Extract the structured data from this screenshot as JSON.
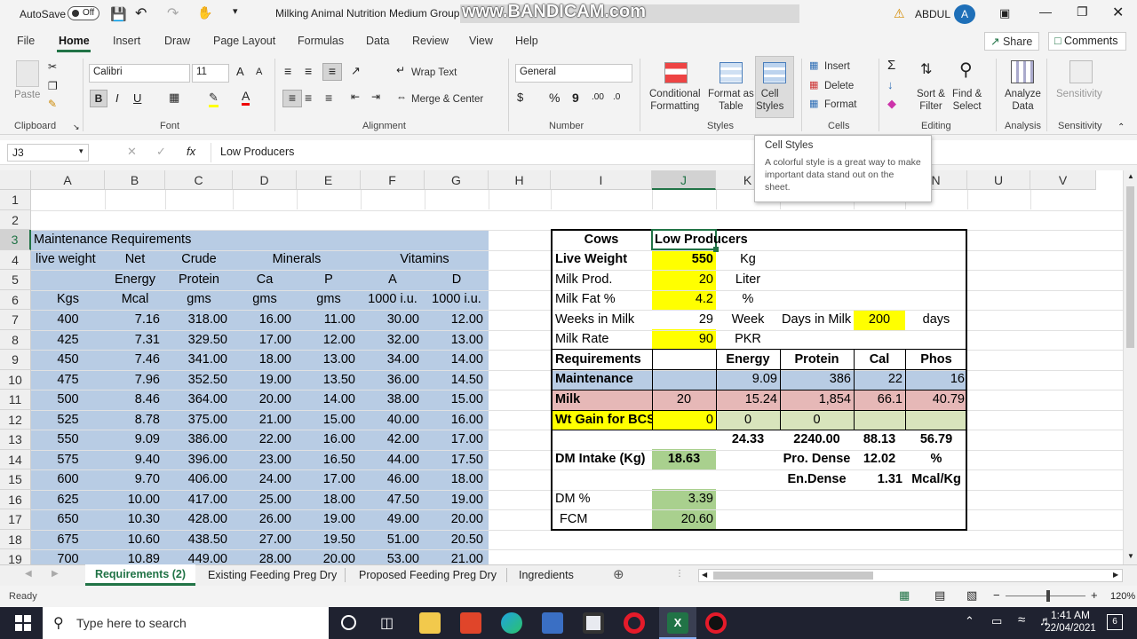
{
  "titlebar": {
    "autosave": "AutoSave",
    "autosave_state": "Off",
    "title": "Milking Animal Nutrition Medium Group",
    "watermark": "www.BANDICAM.com",
    "user": "ABDUL",
    "avatar": "A"
  },
  "menu": {
    "items": [
      "File",
      "Home",
      "Insert",
      "Draw",
      "Page Layout",
      "Formulas",
      "Data",
      "Review",
      "View",
      "Help"
    ],
    "share": "Share",
    "comments": "Comments"
  },
  "ribbon": {
    "clipboard": {
      "paste": "Paste",
      "group": "Clipboard"
    },
    "font": {
      "name": "Calibri",
      "size": "11",
      "bold": "B",
      "italic": "I",
      "underline": "U",
      "group": "Font",
      "grow": "A",
      "shrink": "A"
    },
    "alignment": {
      "wrap": "Wrap Text",
      "merge": "Merge & Center",
      "group": "Alignment"
    },
    "number": {
      "format": "General",
      "group": "Number",
      "currency": "$",
      "percent": "%",
      "comma": "9"
    },
    "styles": {
      "cond1": "Conditional",
      "cond2": "Formatting",
      "fmt1": "Format as",
      "fmt2": "Table",
      "cell1": "Cell",
      "cell2": "Styles",
      "group": "Styles"
    },
    "cells": {
      "insert": "Insert",
      "delete": "Delete",
      "format": "Format",
      "group": "Cells"
    },
    "editing": {
      "sort1": "Sort &",
      "sort2": "Filter",
      "find1": "Find &",
      "find2": "Select",
      "group": "Editing"
    },
    "analysis": {
      "a1": "Analyze",
      "a2": "Data",
      "group": "Analysis"
    },
    "sensitivity": {
      "s1": "Sensitivity",
      "group": "Sensitivity"
    }
  },
  "tooltip": {
    "title": "Cell Styles",
    "body": "A colorful style is a great way to make important data stand out on the sheet."
  },
  "formula_bar": {
    "name_box": "J3",
    "fx": "fx",
    "content": "Low Producers"
  },
  "columns": [
    "A",
    "B",
    "C",
    "D",
    "E",
    "F",
    "G",
    "H",
    "I",
    "J",
    "K",
    "L",
    "M",
    "N",
    "U",
    "V"
  ],
  "rows": [
    "1",
    "2",
    "3",
    "4",
    "5",
    "6",
    "7",
    "8",
    "9",
    "10",
    "11",
    "12",
    "13",
    "14",
    "15",
    "16",
    "17",
    "18",
    "19"
  ],
  "left_table": {
    "title": "Maintenance Requirements",
    "h1": [
      "live weight",
      "Net",
      "Crude",
      "Minerals",
      "Vitamins"
    ],
    "h2": [
      "Energy",
      "Protein",
      "Ca",
      "P",
      "A",
      "D"
    ],
    "h3": [
      "Kgs",
      "Mcal",
      "gms",
      "gms",
      "gms",
      "1000 i.u.",
      "1000 i.u."
    ],
    "data": [
      [
        "400",
        "7.16",
        "318.00",
        "16.00",
        "11.00",
        "30.00",
        "12.00"
      ],
      [
        "425",
        "7.31",
        "329.50",
        "17.00",
        "12.00",
        "32.00",
        "13.00"
      ],
      [
        "450",
        "7.46",
        "341.00",
        "18.00",
        "13.00",
        "34.00",
        "14.00"
      ],
      [
        "475",
        "7.96",
        "352.50",
        "19.00",
        "13.50",
        "36.00",
        "14.50"
      ],
      [
        "500",
        "8.46",
        "364.00",
        "20.00",
        "14.00",
        "38.00",
        "15.00"
      ],
      [
        "525",
        "8.78",
        "375.00",
        "21.00",
        "15.00",
        "40.00",
        "16.00"
      ],
      [
        "550",
        "9.09",
        "386.00",
        "22.00",
        "16.00",
        "42.00",
        "17.00"
      ],
      [
        "575",
        "9.40",
        "396.00",
        "23.00",
        "16.50",
        "44.00",
        "17.50"
      ],
      [
        "600",
        "9.70",
        "406.00",
        "24.00",
        "17.00",
        "46.00",
        "18.00"
      ],
      [
        "625",
        "10.00",
        "417.00",
        "25.00",
        "18.00",
        "47.50",
        "19.00"
      ],
      [
        "650",
        "10.30",
        "428.00",
        "26.00",
        "19.00",
        "49.00",
        "20.00"
      ],
      [
        "675",
        "10.60",
        "438.50",
        "27.00",
        "19.50",
        "51.00",
        "20.50"
      ],
      [
        "700",
        "10.89",
        "449.00",
        "28.00",
        "20.00",
        "53.00",
        "21.00"
      ]
    ]
  },
  "right_table": {
    "cows": "Cows",
    "low": "Low Producers",
    "live_weight": "Live Weight",
    "lw_val": "550",
    "kg": "Kg",
    "milk_prod": "Milk Prod.",
    "mp_val": "20",
    "liter": "Liter",
    "milk_fat": "Milk Fat %",
    "mf_val": "4.2",
    "pct": "%",
    "weeks": "Weeks in Milk",
    "wk_val": "29",
    "week": "Week",
    "days_in_milk": "Days in Milk",
    "dim_val": "200",
    "days": "days",
    "milk_rate": "Milk Rate",
    "mr_val": "90",
    "pkr": "PKR",
    "req": "Requirements",
    "energy": "Energy",
    "protein": "Protein",
    "cal": "Cal",
    "phos": "Phos",
    "maint": "Maintenance",
    "m_e": "9.09",
    "m_p": "386",
    "m_c": "22",
    "m_ph": "16",
    "milk": "Milk",
    "mk_j": "20",
    "mk_e": "15.24",
    "mk_p": "1,854",
    "mk_c": "66.1",
    "mk_ph": "40.79",
    "wtgain": "Wt Gain for BCS",
    "wg_j": "0",
    "wg_e": "0",
    "wg_p": "0",
    "t_e": "24.33",
    "t_p": "2240.00",
    "t_c": "88.13",
    "t_ph": "56.79",
    "dmi": "DM Intake (Kg)",
    "dmi_val": "18.63",
    "pro_dense": "Pro. Dense",
    "pd_val": "12.02",
    "pd_unit": "%",
    "en_dense": "En.Dense",
    "ed_val": "1.31",
    "ed_unit": "Mcal/Kg",
    "dm_pct": "DM %",
    "dm_val": "3.39",
    "fcm": "FCM",
    "fcm_val": "20.60"
  },
  "tabs": [
    "Requirements (2)",
    "Existing Feeding Preg Dry",
    "Proposed Feeding Preg Dry",
    "Ingredients"
  ],
  "status": {
    "ready": "Ready",
    "zoom": "120%"
  },
  "taskbar": {
    "search": "Type here to search",
    "time": "1:41 AM",
    "date": "22/04/2021"
  },
  "colors": {
    "blue_fill": "#b8cce4",
    "yellow": "#ffff00",
    "green": "#a9d08e",
    "pink": "#e6b8b7",
    "lightgreen": "#d8e4bc",
    "accent": "#217346"
  }
}
